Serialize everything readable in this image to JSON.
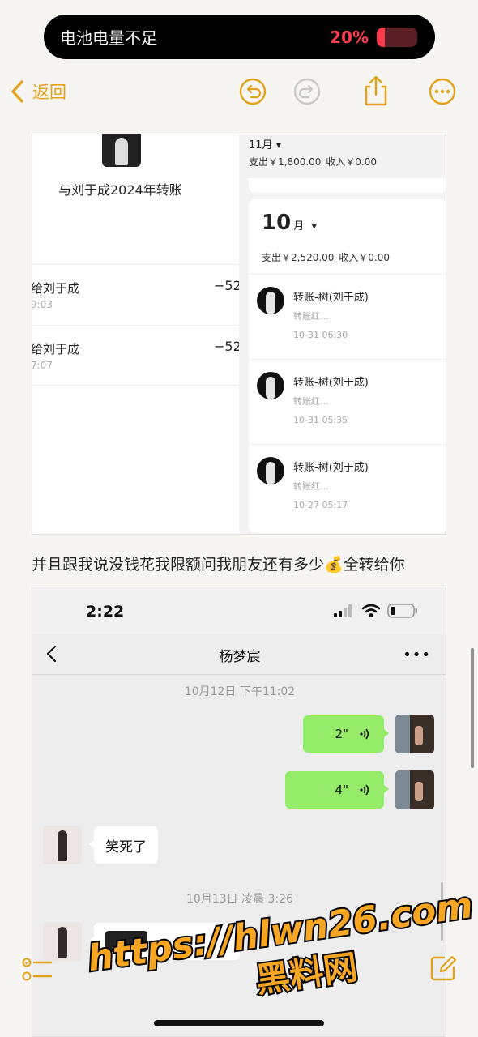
{
  "banner": {
    "message": "电池电量不足",
    "percent": "20%",
    "level": 0.2,
    "color": "#ff3b4e"
  },
  "topbar": {
    "back_label": "返回",
    "accent": "#e2a21c"
  },
  "shot1": {
    "left": {
      "title": "与刘于成2024年转账",
      "rows": [
        {
          "name": "给刘于成",
          "time": "9:03",
          "amount": "−52("
        },
        {
          "name": "给刘于成",
          "time": "7:07",
          "amount": "−52("
        }
      ]
    },
    "right": {
      "prev_month": "11月",
      "prev_summary": "支出￥1,800.00    收入￥0.00",
      "month_num": "10",
      "month_unit": "月",
      "month_summary": "支出￥2,520.00    收入￥0.00",
      "transactions": [
        {
          "title": "转账-树(刘于成)",
          "sub": "转账红...",
          "date": "10-31 06:30"
        },
        {
          "title": "转账-树(刘于成)",
          "sub": "转账红...",
          "date": "10-31 05:35"
        },
        {
          "title": "转账-树(刘于成)",
          "sub": "转账红...",
          "date": "10-27 05:17"
        }
      ]
    }
  },
  "caption": "并且跟我说没钱花我限额问我朋友还有多少💰全转给你",
  "wechat": {
    "status_time": "2:22",
    "contact": "杨梦宸",
    "more": "•••",
    "stamp1": "10月12日 下午11:02",
    "voice1": "2\"",
    "voice2": "4\"",
    "text1": "笑死了",
    "stamp2": "10月13日 凌晨 3:26",
    "bubble_color": "#95ec69"
  },
  "watermark": {
    "url": "https://hlwn26.com",
    "name": "黑料网",
    "color": "#f6a623"
  }
}
